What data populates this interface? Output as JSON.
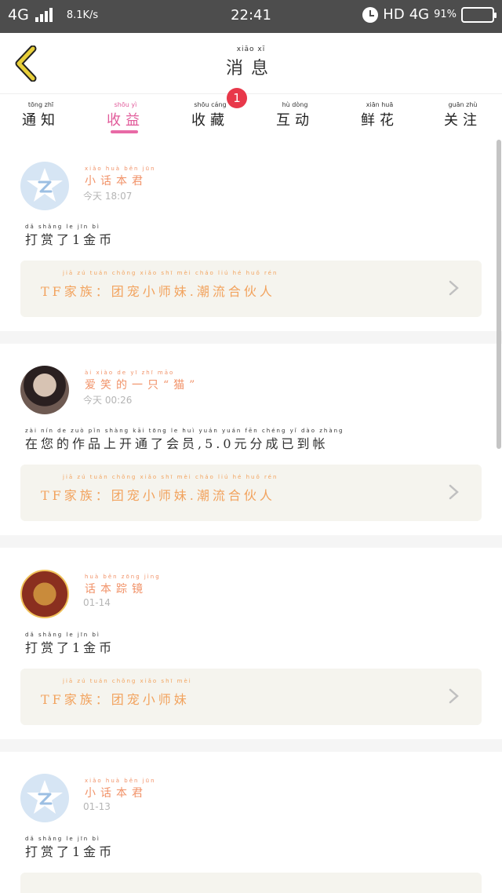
{
  "status_bar": {
    "network": "4G",
    "speed": "8.1K/s",
    "time": "22:41",
    "hd": "HD",
    "net_right": "4G",
    "battery": "91%"
  },
  "header": {
    "title_pinyin": "xiāo xī",
    "title": "消息"
  },
  "tabs": [
    {
      "label": "通知",
      "pinyin": "tōng zhī",
      "active": false
    },
    {
      "label": "收益",
      "pinyin": "shōu yì",
      "active": true
    },
    {
      "label": "收藏",
      "pinyin": "shōu cáng",
      "active": false,
      "badge": "1"
    },
    {
      "label": "互动",
      "pinyin": "hù dòng",
      "active": false
    },
    {
      "label": "鲜花",
      "pinyin": "xiān huā",
      "active": false
    },
    {
      "label": "关注",
      "pinyin": "guān zhù",
      "active": false
    }
  ],
  "messages": [
    {
      "user": "小话本君",
      "user_pinyin": "xiǎo huà běn jūn",
      "time": "今天 18:07",
      "text": "打赏了1金币",
      "text_pinyin": "dǎ shǎng le jīn bì",
      "work": "TF家族：团宠小师妹.潮流合伙人",
      "work_pinyin": "jiā zú tuán chǒng xiǎo shī mèi cháo liú hé huǒ rén"
    },
    {
      "user": "爱笑的一只“猫”",
      "user_pinyin": "ài xiào de yī zhī māo",
      "time": "今天 00:26",
      "text": "在您的作品上开通了会员,5.0元分成已到帐",
      "text_pinyin": "zài nín de zuò pǐn shàng kāi tōng le huì yuán yuán fēn chéng yǐ dào zhàng",
      "work": "TF家族：团宠小师妹.潮流合伙人",
      "work_pinyin": "jiā zú tuán chǒng xiǎo shī mèi cháo liú hé huǒ rén"
    },
    {
      "user": "话本踪镜",
      "user_pinyin": "huà běn zōng jìng",
      "time": "01-14",
      "text": "打赏了1金币",
      "text_pinyin": "dǎ shǎng le jīn bì",
      "work": "TF家族：团宠小师妹",
      "work_pinyin": "jiā zú tuán chǒng xiǎo shī mèi"
    },
    {
      "user": "小话本君",
      "user_pinyin": "xiǎo huà běn jūn",
      "time": "01-13",
      "text": "打赏了1金币",
      "text_pinyin": "dǎ shǎng le jīn bì",
      "work": "",
      "work_pinyin": ""
    }
  ],
  "colors": {
    "accent_pink": "#e15a9a",
    "user_orange": "#f19268",
    "work_orange": "#f2a35e",
    "badge_red": "#e8384a",
    "statusbar": "#4d4d4d"
  }
}
